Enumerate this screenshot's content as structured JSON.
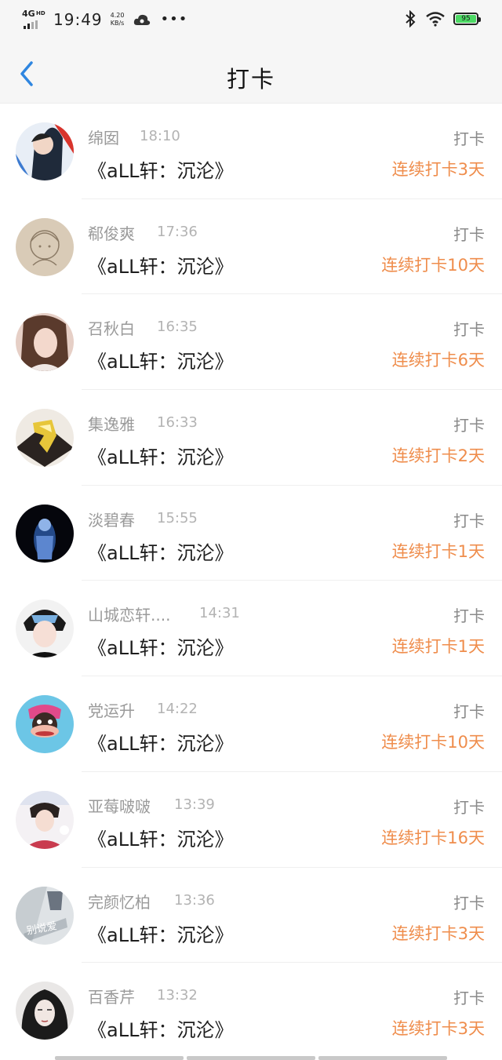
{
  "status_bar": {
    "network": "4G",
    "network_sup": "HD",
    "time": "19:49",
    "speed_value": "4.20",
    "speed_unit": "KB/s",
    "more": "•••",
    "battery": "95"
  },
  "header": {
    "title": "打卡"
  },
  "entries": [
    {
      "name": "绵囡",
      "time": "18:10",
      "work": "《aLL轩：沉沦》",
      "action": "打卡",
      "streak": "连续打卡3天"
    },
    {
      "name": "郗俊爽",
      "time": "17:36",
      "work": "《aLL轩：沉沦》",
      "action": "打卡",
      "streak": "连续打卡10天"
    },
    {
      "name": "召秋白",
      "time": "16:35",
      "work": "《aLL轩：沉沦》",
      "action": "打卡",
      "streak": "连续打卡6天"
    },
    {
      "name": "集逸雅",
      "time": "16:33",
      "work": "《aLL轩：沉沦》",
      "action": "打卡",
      "streak": "连续打卡2天"
    },
    {
      "name": "淡碧春",
      "time": "15:55",
      "work": "《aLL轩：沉沦》",
      "action": "打卡",
      "streak": "连续打卡1天"
    },
    {
      "name": "山城恋轩....",
      "time": "14:31",
      "work": "《aLL轩：沉沦》",
      "action": "打卡",
      "streak": "连续打卡1天"
    },
    {
      "name": "党运升",
      "time": "14:22",
      "work": "《aLL轩：沉沦》",
      "action": "打卡",
      "streak": "连续打卡10天"
    },
    {
      "name": "亚莓啵啵",
      "time": "13:39",
      "work": "《aLL轩：沉沦》",
      "action": "打卡",
      "streak": "连续打卡16天"
    },
    {
      "name": "完颜忆柏",
      "time": "13:36",
      "work": "《aLL轩：沉沦》",
      "action": "打卡",
      "streak": "连续打卡3天"
    },
    {
      "name": "百香芹",
      "time": "13:32",
      "work": "《aLL轩：沉沦》",
      "action": "打卡",
      "streak": "连续打卡3天"
    }
  ],
  "avatar_art": {
    "avatar_9_text": "别说爱"
  },
  "colors": {
    "accent": "#2f86e0",
    "streak": "#ef8d4c",
    "muted": "#9a9a9a"
  }
}
